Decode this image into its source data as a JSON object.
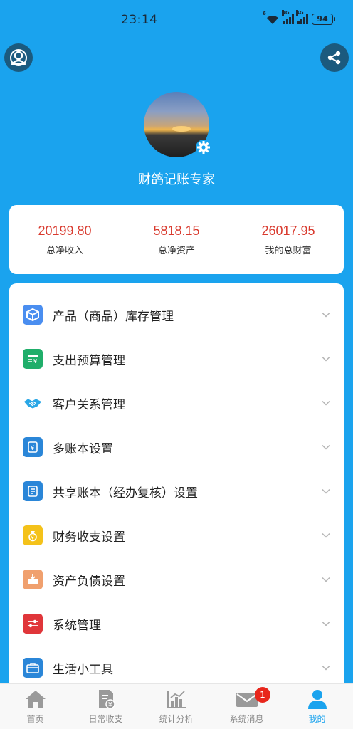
{
  "status_bar": {
    "time": "23:14",
    "battery": "94",
    "network_1": "4G",
    "network_2": "4G",
    "wifi_tag": "6"
  },
  "header": {
    "user_name": "财鸽记账专家"
  },
  "stats": [
    {
      "value": "20199.80",
      "label": "总净收入"
    },
    {
      "value": "5818.15",
      "label": "总净资产"
    },
    {
      "value": "26017.95",
      "label": "我的总财富"
    }
  ],
  "menu": [
    {
      "label": "产品（商品）库存管理",
      "icon": "box-icon",
      "color": "#4a8ef0"
    },
    {
      "label": "支出预算管理",
      "icon": "budget-icon",
      "color": "#1fae6a"
    },
    {
      "label": "客户关系管理",
      "icon": "handshake-icon",
      "color": "#2aa7e6"
    },
    {
      "label": "多账本设置",
      "icon": "ledger-icon",
      "color": "#2a86d8"
    },
    {
      "label": "共享账本（经办复核）设置",
      "icon": "shared-ledger-icon",
      "color": "#2a86d8"
    },
    {
      "label": "财务收支设置",
      "icon": "money-bag-icon",
      "color": "#f4c21a"
    },
    {
      "label": "资产负债设置",
      "icon": "assets-icon",
      "color": "#f0a06e"
    },
    {
      "label": "系统管理",
      "icon": "system-icon",
      "color": "#e0363a"
    },
    {
      "label": "生活小工具",
      "icon": "toolbox-icon",
      "color": "#2a86d8"
    }
  ],
  "tabs": [
    {
      "label": "首页",
      "icon": "home-icon"
    },
    {
      "label": "日常收支",
      "icon": "receipt-icon"
    },
    {
      "label": "统计分析",
      "icon": "chart-icon"
    },
    {
      "label": "系统消息",
      "icon": "mail-icon",
      "badge": "1"
    },
    {
      "label": "我的",
      "icon": "person-icon",
      "active": true
    }
  ],
  "colors": {
    "brand": "#1aa3ee",
    "stat_value": "#d93a2e",
    "badge": "#e8261c"
  }
}
